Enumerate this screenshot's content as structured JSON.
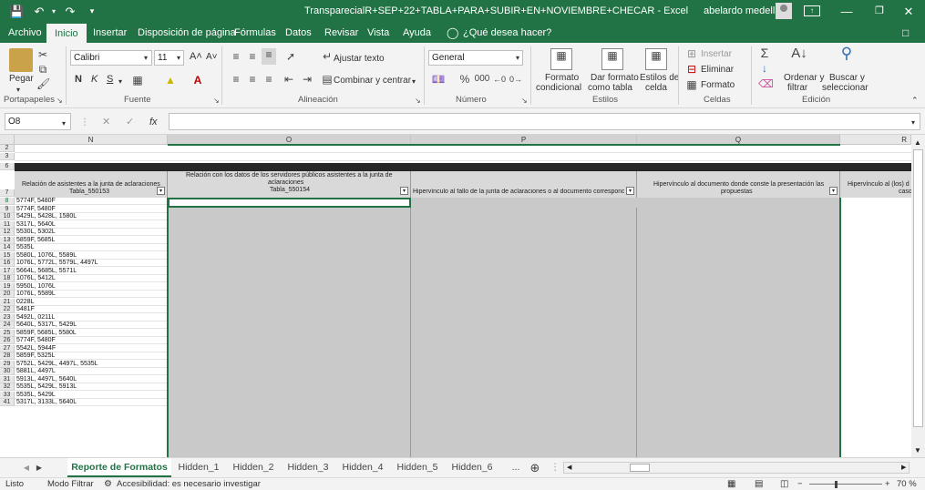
{
  "title": {
    "file": "TransparecialR+SEP+22+TABLA+PARA+SUBIR+EN+NOVIEMBRE+CHECAR  -  Excel",
    "user": "abelardo medellin"
  },
  "menu": [
    "Archivo",
    "Inicio",
    "Insertar",
    "Disposición de página",
    "Fórmulas",
    "Datos",
    "Revisar",
    "Vista",
    "Ayuda",
    "¿Qué desea hacer?"
  ],
  "ribbon": {
    "pegar": "Pegar",
    "portapapeles": "Portapapeles",
    "font_name": "Calibri",
    "font_size": "11",
    "bold": "N",
    "italic": "K",
    "underline": "S",
    "fuente": "Fuente",
    "ajustar": "Ajustar texto",
    "combinar": "Combinar y centrar",
    "alineacion": "Alineación",
    "number_format": "General",
    "numero": "Número",
    "formato_cond_1": "Formato",
    "formato_cond_2": "condicional",
    "formato_tabla_1": "Dar formato",
    "formato_tabla_2": "como tabla",
    "estilos_celda_1": "Estilos de",
    "estilos_celda_2": "celda",
    "estilos": "Estilos",
    "insertar": "Insertar",
    "eliminar": "Eliminar",
    "formato": "Formato",
    "celdas": "Celdas",
    "ordenar_1": "Ordenar y",
    "ordenar_2": "filtrar",
    "buscar_1": "Buscar y",
    "buscar_2": "seleccionar",
    "edicion": "Edición"
  },
  "formula": {
    "namebox": "O8",
    "fx": "fx",
    "content": ""
  },
  "columns": [
    "N",
    "O",
    "P",
    "Q",
    "R"
  ],
  "headers": {
    "n_1": "Relación de asistentes a la junta de aclaraciones",
    "n_2": "Tabla_550153",
    "o_1": "Relación con los datos de los servidores públicos asistentes a la junta de",
    "o_2": "aclaraciones",
    "o_3": "Tabla_550154",
    "p_1": "Hipervínculo al fallo de la junta de aclaraciones o al documento correspondie",
    "q_1": "Hipervínculo al documento donde conste la presentación las",
    "q_2": "propuestas",
    "r_1": "Hipervínculo al (los) d",
    "r_2": "caso"
  },
  "row_numbers": [
    "2",
    "3",
    "6",
    "7",
    "8",
    "9",
    "10",
    "11",
    "12",
    "13",
    "14",
    "15",
    "16",
    "17",
    "18",
    "19",
    "20",
    "21",
    "22",
    "23",
    "24",
    "25",
    "26",
    "27",
    "28",
    "29",
    "30",
    "31",
    "32",
    "33",
    "41"
  ],
  "rows": [
    "5774F, 5480F",
    "5774F, 5480F",
    "5429L, 5428L, 1580L",
    "5317L, 5640L",
    "5530L, 5302L",
    "5859F, 5685L",
    "5535L",
    "5580L, 1076L, 5589L",
    "1076L, 5772L, 5579L, 4497L",
    "5664L, 5685L, 5571L",
    "1076L, 5412L",
    "5950L, 1076L",
    "1076L, 5589L",
    "0228L",
    "5481F",
    "5492L, 0211L",
    "5640L, 5317L, 5429L",
    "5859F, 5685L, 5580L",
    "5774F, 5480F",
    "5542L, 5944F",
    "5859F, 5325L",
    "5752L, 5429L, 4497L, 5535L",
    "5881L, 4497L",
    "5913L, 4497L, 5640L",
    "5535L, 5429L, 5913L",
    "5535L, 5429L",
    "5317L, 3133L, 5640L"
  ],
  "sheets": [
    "Reporte de Formatos",
    "Hidden_1",
    "Hidden_2",
    "Hidden_3",
    "Hidden_4",
    "Hidden_5",
    "Hidden_6",
    "..."
  ],
  "status": {
    "ready": "Listo",
    "mode": "Modo Filtrar",
    "accessibility": "Accesibilidad: es necesario investigar",
    "zoom": "70 %"
  }
}
